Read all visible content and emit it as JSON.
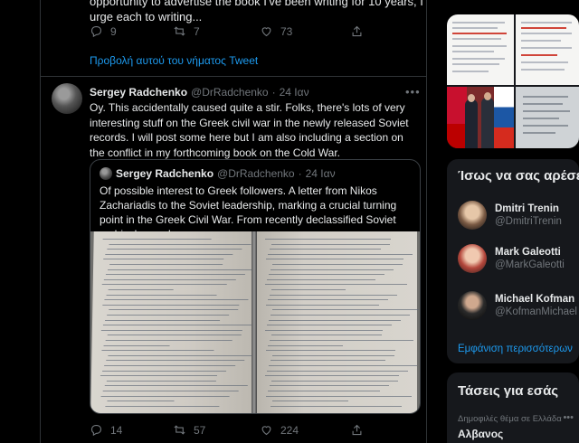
{
  "previous_tweet": {
    "text_tail": "opportunity to advertise the book I've been writing for 10 years, I urge each to writing...",
    "actions": {
      "replies": "9",
      "retweets": "7",
      "likes": "73"
    },
    "show_thread_label": "Προβολή αυτού του νήματος Tweet"
  },
  "tweet": {
    "author_name": "Sergey Radchenko",
    "handle": "@DrRadchenko",
    "separator": "·",
    "date": "24 Ιαν",
    "more_icon": "more-dots-icon",
    "text": "Oy. This accidentally caused quite a stir. Folks, there's lots of very interesting stuff on the Greek civil war in the newly released Soviet records. I will post some here but I am also including a section on the conflict in my forthcoming book on the Cold War.",
    "quote": {
      "author_name": "Sergey Radchenko",
      "handle": "@DrRadchenko",
      "separator": "·",
      "date": "24 Ιαν",
      "text": "Of possible interest to Greek followers. A letter from Nikos Zachariadis to the Soviet leadership, marking a crucial turning point in the Greek Civil War. From recently declassified Soviet archival records.",
      "image_desc_icon": "handwritten-document-photo"
    },
    "actions": {
      "replies": "14",
      "retweets": "57",
      "likes": "224"
    }
  },
  "sidebar": {
    "who_to_follow": {
      "title": "Ίσως να σας αρέσει",
      "accounts": [
        {
          "name": "Dmitri Trenin",
          "handle": "@DmitriTrenin"
        },
        {
          "name": "Mark Galeotti",
          "handle": "@MarkGaleotti"
        },
        {
          "name": "Michael Kofman",
          "handle": "@KofmanMichael"
        }
      ],
      "show_more": "Εμφάνιση περισσότερων"
    },
    "trends": {
      "title": "Τάσεις για εσάς",
      "context": "Δημοφιλές θέμα σε Ελλάδα",
      "name": "Αλβανος",
      "more_icon": "more-dots-icon"
    }
  },
  "colors": {
    "accent": "#1d9bf0",
    "background": "#000000",
    "border": "#2f3336",
    "muted": "#71767b"
  }
}
